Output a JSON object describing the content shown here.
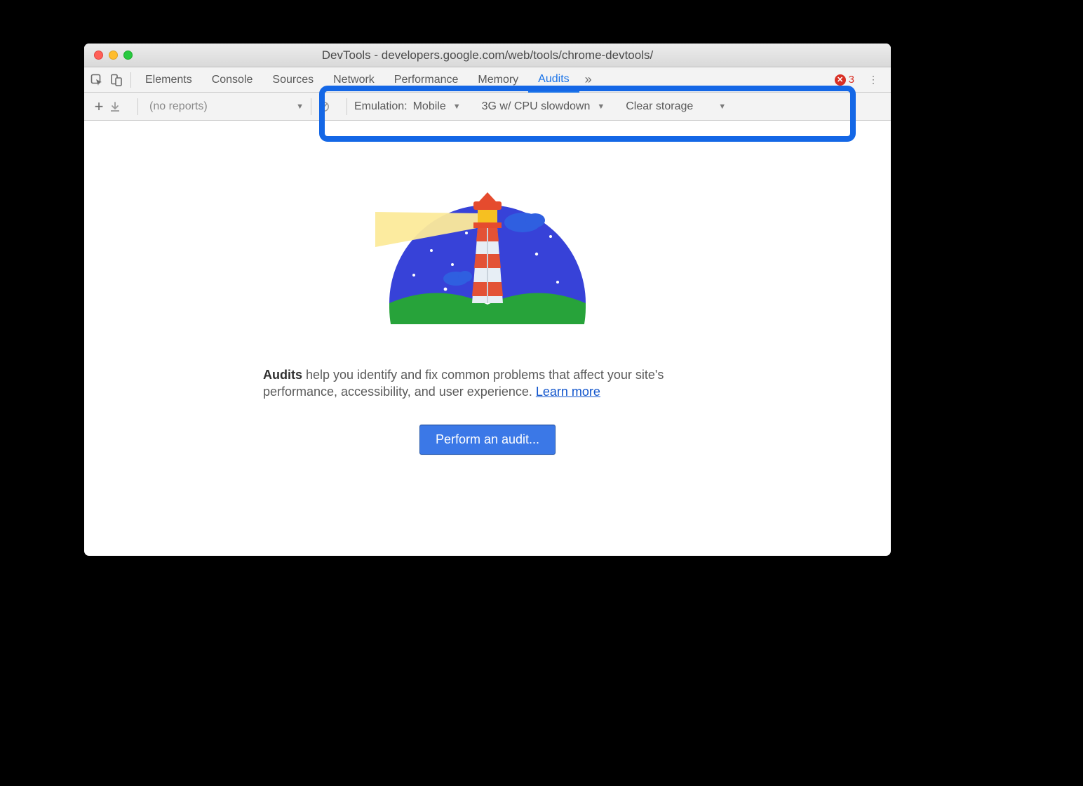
{
  "window": {
    "title": "DevTools - developers.google.com/web/tools/chrome-devtools/"
  },
  "tabs": {
    "items": [
      "Elements",
      "Console",
      "Sources",
      "Network",
      "Performance",
      "Memory",
      "Audits"
    ],
    "active": "Audits",
    "error_count": "3"
  },
  "toolbar": {
    "reports_label": "(no reports)",
    "emulation_label": "Emulation:",
    "emulation_value": "Mobile",
    "throttle_value": "3G w/ CPU slowdown",
    "storage_value": "Clear storage"
  },
  "main": {
    "desc_bold": "Audits",
    "desc_rest": " help you identify and fix common problems that affect your site's performance, accessibility, and user experience. ",
    "learn_more": "Learn more",
    "button": "Perform an audit..."
  }
}
